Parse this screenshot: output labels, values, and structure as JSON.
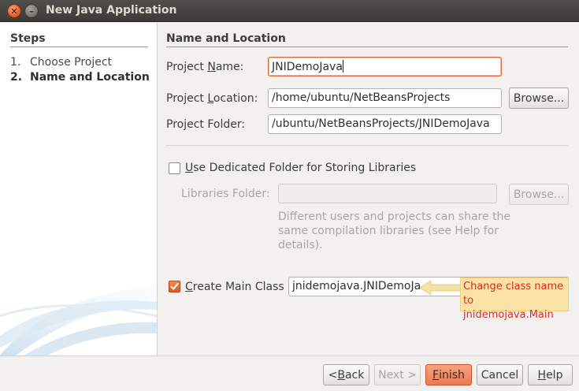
{
  "window": {
    "title": "New Java Application"
  },
  "steps": {
    "title": "Steps",
    "items": [
      {
        "num": "1.",
        "label": "Choose Project"
      },
      {
        "num": "2.",
        "label": "Name and Location"
      }
    ]
  },
  "section": {
    "title": "Name and Location"
  },
  "project_name": {
    "label_pre": "Project ",
    "label_key": "N",
    "label_post": "ame:",
    "value": "JNIDemoJava"
  },
  "project_location": {
    "label_pre": "Project ",
    "label_key": "L",
    "label_post": "ocation:",
    "value": "/home/ubuntu/NetBeansProjects",
    "browse": "Browse..."
  },
  "project_folder": {
    "label": "Project Folder:",
    "value": "/ubuntu/NetBeansProjects/JNIDemoJava"
  },
  "dedicated_folder": {
    "label_key": "U",
    "label_post": "se Dedicated Folder for Storing Libraries",
    "checked": false
  },
  "libraries_folder": {
    "label": "Libraries Folder:",
    "value": "",
    "browse": "Browse..."
  },
  "libraries_help": "Different users and projects can share the same compilation libraries (see Help for details).",
  "main_class": {
    "label_key": "C",
    "label_post": "reate Main Class",
    "checked": true,
    "value": "jnidemojava.JNIDemoJa"
  },
  "annotation": {
    "line1": "Change class name to",
    "line2": "jnidemojava.Main"
  },
  "buttons": {
    "back": {
      "pre": "< ",
      "key": "B",
      "post": "ack"
    },
    "next": {
      "label": "Next >"
    },
    "finish": {
      "key": "F",
      "post": "inish"
    },
    "cancel": "Cancel",
    "help": {
      "key": "H",
      "post": "elp"
    }
  },
  "colors": {
    "accent": "#e0683a",
    "annotation_text": "#d92b1f",
    "annotation_bg": "#fbe3a8"
  }
}
